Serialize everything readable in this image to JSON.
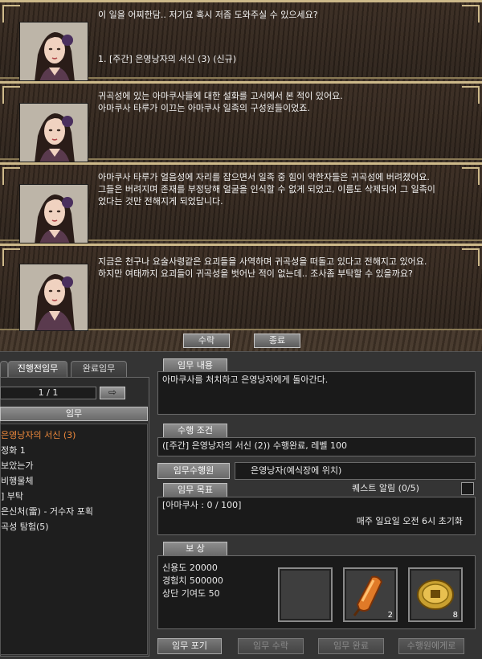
{
  "dialog": {
    "panels": [
      {
        "lines": [
          "이 일을 어찌한담.. 저기요 혹시 저좀 도와주실 수 있으세요?"
        ],
        "option": "1. [주간] 은영낭자의 서신 (3) (신규)"
      },
      {
        "lines": [
          "귀곡성에 있는 아마쿠사들에 대한 설화를 고서에서 본 적이 있어요.",
          "아마쿠사 타루가 이끄는 아마쿠사 일족의 구성원들이었죠."
        ]
      },
      {
        "lines": [
          "아마쿠사 타루가 얼음성에 자리를 잡으면서 일족 중 힘이 약한자들은 귀곡성에 버려졌어요.",
          "그들은 버려지며 존재를 부정당해 얼굴을 인식할 수 없게 되었고, 이름도 삭제되어 그 일족이",
          "었다는 것만 전해지게 되었답니다."
        ]
      },
      {
        "lines": [
          "지금은 천구나 요술사령같은 요괴들을 사역하며 귀곡성을 떠돌고 있다고 전해지고 있어요.",
          "하지만 여태까지 요괴들이 귀곡성을 벗어난 적이 없는데.. 조사좀 부탁할 수 있을까요?"
        ]
      }
    ],
    "accept_label": "수락",
    "close_label": "종료"
  },
  "quest": {
    "tabs": [
      {
        "label": ""
      },
      {
        "label": "진행전임무"
      },
      {
        "label": "완료임무"
      }
    ],
    "page": "1 / 1",
    "page_arrow": "⇨",
    "list_header": "임무",
    "list": [
      "은영낭자의 서신 (3)",
      "정화 1",
      "보았는가",
      "비행물체",
      "] 부탁",
      "은신처(雷) - 거수자 포획",
      "곡성 탐험(5)"
    ],
    "content_label": "임무 내용",
    "content": "아마쿠사를 처치하고 은영낭자에게 돌아간다.",
    "condition_label": "수행 조건",
    "condition": "([주간] 은영낭자의 서신 (2)) 수행완료, 레벨 100",
    "performer_label": "임무수행원",
    "performer": "은영낭자(예식장에 위치)",
    "goal_label": "임무 목표",
    "alarm_label": "퀘스트 알림 (0/5)",
    "goal": "[아마쿠사 : 0 / 100]",
    "reset": "매주 일요일 오전 6시 초기화",
    "reward_label": "보    상",
    "rewards_text": [
      "신용도 20000",
      "경험치 500000",
      "상단 기여도 50"
    ],
    "reward_slots": [
      {
        "icon": "empty-slot",
        "count": ""
      },
      {
        "icon": "amber-charm-icon",
        "count": "2"
      },
      {
        "icon": "gold-coin-icon",
        "count": "8"
      }
    ],
    "buttons": [
      "임무 포기",
      "임무 수락",
      "임무 완료",
      "수행원에게로"
    ]
  }
}
